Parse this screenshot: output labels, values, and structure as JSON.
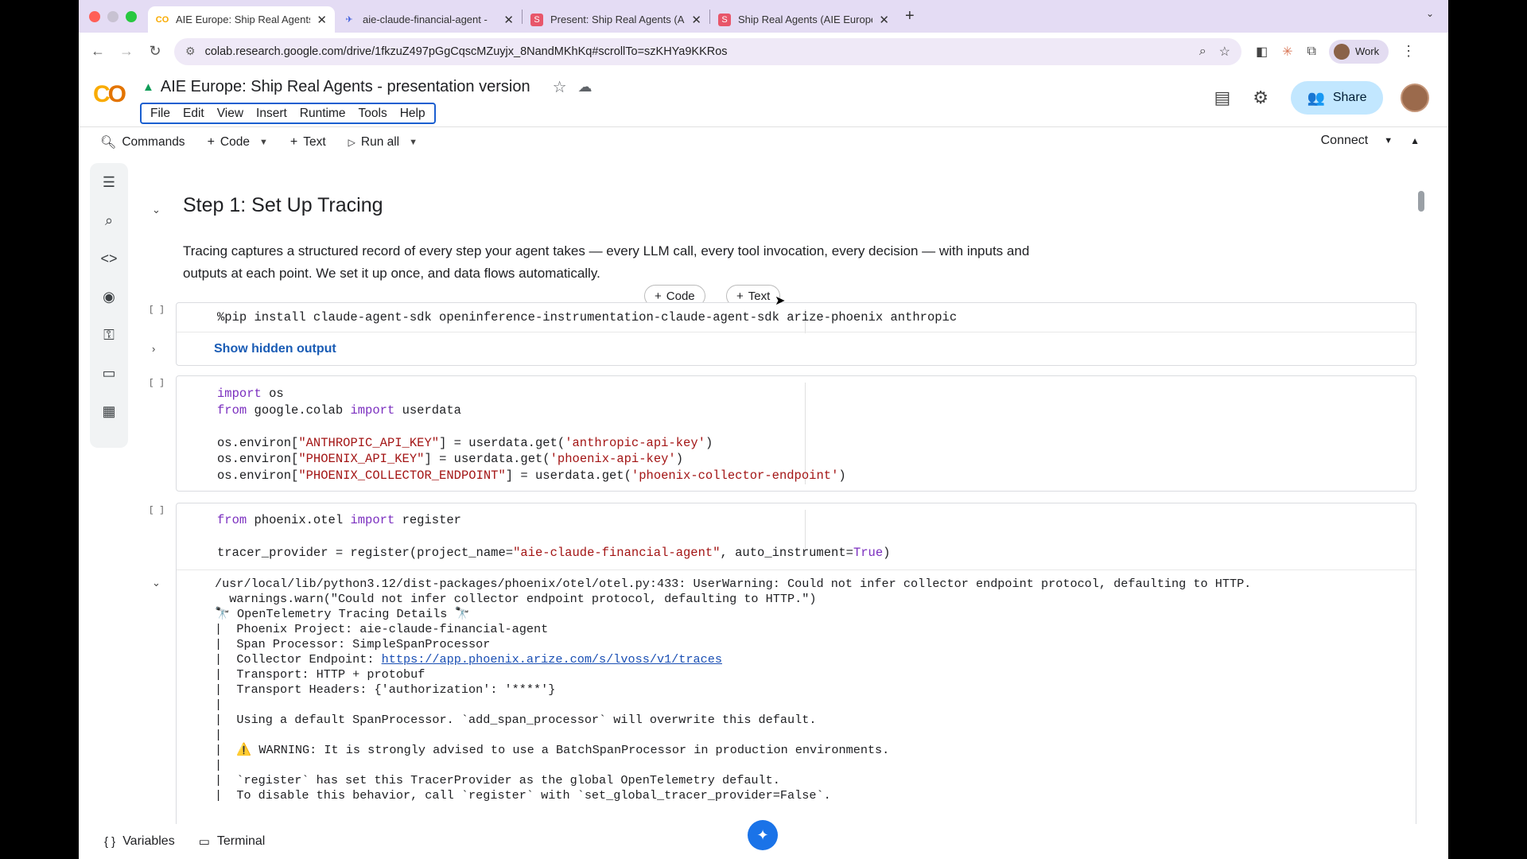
{
  "browser": {
    "tabs": [
      {
        "title": "AIE Europe: Ship Real Agents",
        "favicon": "colab-icon",
        "active": true
      },
      {
        "title": "aie-claude-financial-agent - ",
        "favicon": "phoenix-icon",
        "active": false
      },
      {
        "title": "Present: Ship Real Agents (Al",
        "favicon": "slides-icon",
        "active": false
      },
      {
        "title": "Ship Real Agents (AIE Europe",
        "favicon": "slides-icon",
        "active": false
      }
    ],
    "url": "colab.research.google.com/drive/1fkzuZ497pGgCqscMZuyjx_8NandMKhKq#scrollTo=szKHYa9KKRos",
    "profile_label": "Work"
  },
  "notebook": {
    "title": "AIE Europe: Ship Real Agents - presentation version",
    "menu": [
      "File",
      "Edit",
      "View",
      "Insert",
      "Runtime",
      "Tools",
      "Help"
    ],
    "share_label": "Share",
    "toolbar": {
      "commands": "Commands",
      "code": "Code",
      "text": "Text",
      "run_all": "Run all",
      "connect": "Connect"
    },
    "heading": "Step 1: Set Up Tracing",
    "paragraph": "Tracing captures a structured record of every step your agent takes — every LLM call, every tool invocation, every decision — with inputs and outputs at each point. We set it up once, and data flows automatically.",
    "add_code": "Code",
    "add_text": "Text",
    "cell1": {
      "bracket": "[ ]",
      "code": "%pip install claude-agent-sdk openinference-instrumentation-claude-agent-sdk arize-phoenix anthropic",
      "hidden_output": "Show hidden output"
    },
    "cell2": {
      "bracket": "[ ]",
      "lines": [
        "import os",
        "from google.colab import userdata",
        "",
        "os.environ[\"ANTHROPIC_API_KEY\"] = userdata.get('anthropic-api-key')",
        "os.environ[\"PHOENIX_API_KEY\"] = userdata.get('phoenix-api-key')",
        "os.environ[\"PHOENIX_COLLECTOR_ENDPOINT\"] = userdata.get('phoenix-collector-endpoint')"
      ]
    },
    "cell3": {
      "bracket": "[ ]",
      "lines": [
        "from phoenix.otel import register",
        "",
        "tracer_provider = register(project_name=\"aie-claude-financial-agent\", auto_instrument=True)"
      ],
      "output": [
        "/usr/local/lib/python3.12/dist-packages/phoenix/otel/otel.py:433: UserWarning: Could not infer collector endpoint protocol, defaulting to HTTP.",
        "  warnings.warn(\"Could not infer collector endpoint protocol, defaulting to HTTP.\")",
        "🔭 OpenTelemetry Tracing Details 🔭",
        "|  Phoenix Project: aie-claude-financial-agent",
        "|  Span Processor: SimpleSpanProcessor",
        "|  Collector Endpoint: ",
        "|  Transport: HTTP + protobuf",
        "|  Transport Headers: {'authorization': '****'}",
        "|",
        "|  Using a default SpanProcessor. `add_span_processor` will overwrite this default.",
        "|",
        "|  ⚠️ WARNING: It is strongly advised to use a BatchSpanProcessor in production environments.",
        "|",
        "|  `register` has set this TracerProvider as the global OpenTelemetry default.",
        "|  To disable this behavior, call `register` with `set_global_tracer_provider=False`."
      ],
      "collector_link": "https://app.phoenix.arize.com/s/lvoss/v1/traces"
    }
  },
  "bottom": {
    "variables": "Variables",
    "terminal": "Terminal"
  }
}
